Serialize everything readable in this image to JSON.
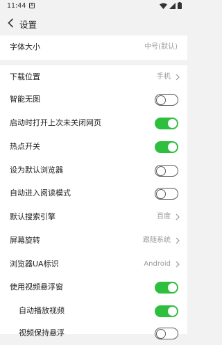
{
  "status_bar": {
    "time": "11:44",
    "notification_glyph": "A",
    "icons": [
      "wifi-icon",
      "signal-icon",
      "battery-icon"
    ]
  },
  "header": {
    "title": "设置",
    "back_icon": "back-arrow-icon"
  },
  "settings": {
    "font_size": {
      "label": "字体大小",
      "value": "中号(默认)"
    },
    "download_location": {
      "label": "下载位置",
      "value": "手机"
    },
    "no_image_mode": {
      "label": "智能无图",
      "enabled": false
    },
    "restore_tabs": {
      "label": "启动时打开上次未关闭网页",
      "enabled": true
    },
    "hot_topics": {
      "label": "热点开关",
      "enabled": true
    },
    "default_browser": {
      "label": "设为默认浏览器",
      "enabled": false
    },
    "auto_reader": {
      "label": "自动进入阅读模式",
      "enabled": false
    },
    "search_engine": {
      "label": "默认搜索引擎",
      "value": "百度"
    },
    "screen_rotation": {
      "label": "屏幕旋转",
      "value": "跟随系统"
    },
    "ua_identifier": {
      "label": "浏览器UA标识",
      "value": "Android"
    },
    "floating_video": {
      "label": "使用视频悬浮窗",
      "enabled": true
    },
    "autoplay_video": {
      "label": "自动播放视频",
      "enabled": true
    },
    "video_keep": {
      "label": "视频保持悬浮",
      "enabled": false
    }
  },
  "colors": {
    "toggle_on": "#2fbf3f",
    "toggle_off_border": "#595959",
    "background": "#f2f2f2"
  }
}
